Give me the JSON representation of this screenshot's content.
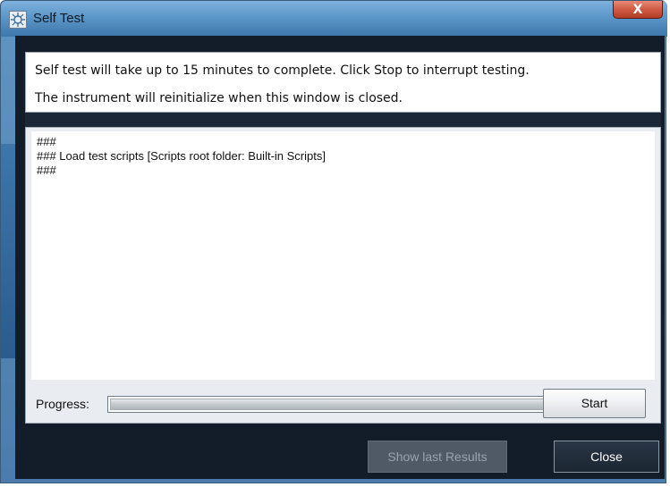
{
  "window": {
    "title": "Self Test",
    "close_glyph": "X",
    "icon": "self-test-icon"
  },
  "info": {
    "line1": "Self test will take up to 15 minutes to complete.  Click Stop to interrupt testing.",
    "line2": "The instrument will reinitialize when this window is closed."
  },
  "log": {
    "lines": [
      "###",
      "### Load test scripts [Scripts root folder: Built-in Scripts]",
      "###"
    ]
  },
  "progress": {
    "label": "Progress:",
    "value": 0
  },
  "buttons": {
    "start": "Start",
    "show_last_results": "Show last Results",
    "close": "Close"
  },
  "colors": {
    "titlebar": "#5c97c9",
    "dialog_bg": "#131d2a",
    "close_x": "#d05a43"
  }
}
